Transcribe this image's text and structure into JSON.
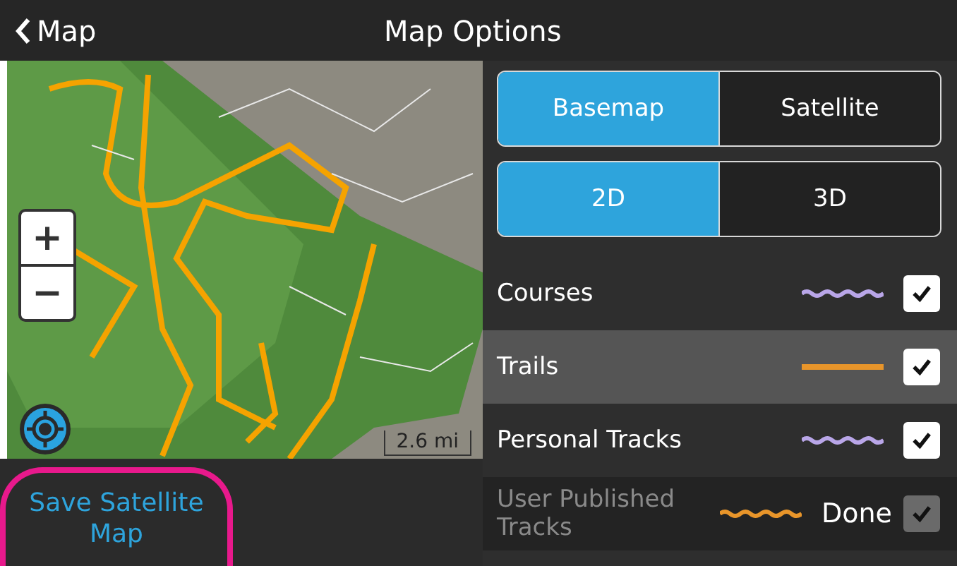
{
  "top_bar": {
    "back_label": "Map",
    "title": "Map Options"
  },
  "map": {
    "zoom_in": "+",
    "zoom_out": "−",
    "scale": "2.6 mi"
  },
  "segments": [
    {
      "options": [
        {
          "label": "Basemap",
          "selected": true
        },
        {
          "label": "Satellite",
          "selected": false
        }
      ]
    },
    {
      "options": [
        {
          "label": "2D",
          "selected": true
        },
        {
          "label": "3D",
          "selected": false
        }
      ]
    }
  ],
  "layers": [
    {
      "label": "Courses",
      "kind": "wavy",
      "color": "#b9a6e8",
      "checked": true,
      "selected": false,
      "disabled": false
    },
    {
      "label": "Trails",
      "kind": "solid",
      "color": "#e8952a",
      "checked": true,
      "selected": true,
      "disabled": false
    },
    {
      "label": "Personal Tracks",
      "kind": "wavy",
      "color": "#b9a6e8",
      "checked": true,
      "selected": false,
      "disabled": false
    },
    {
      "label": "User Published Tracks",
      "kind": "wavy",
      "color": "#e8952a",
      "checked": true,
      "selected": false,
      "disabled": true
    }
  ],
  "bottom_bar": {
    "save_label": "Save Satellite Map",
    "save_highlighted": true,
    "done_label": "Done"
  }
}
